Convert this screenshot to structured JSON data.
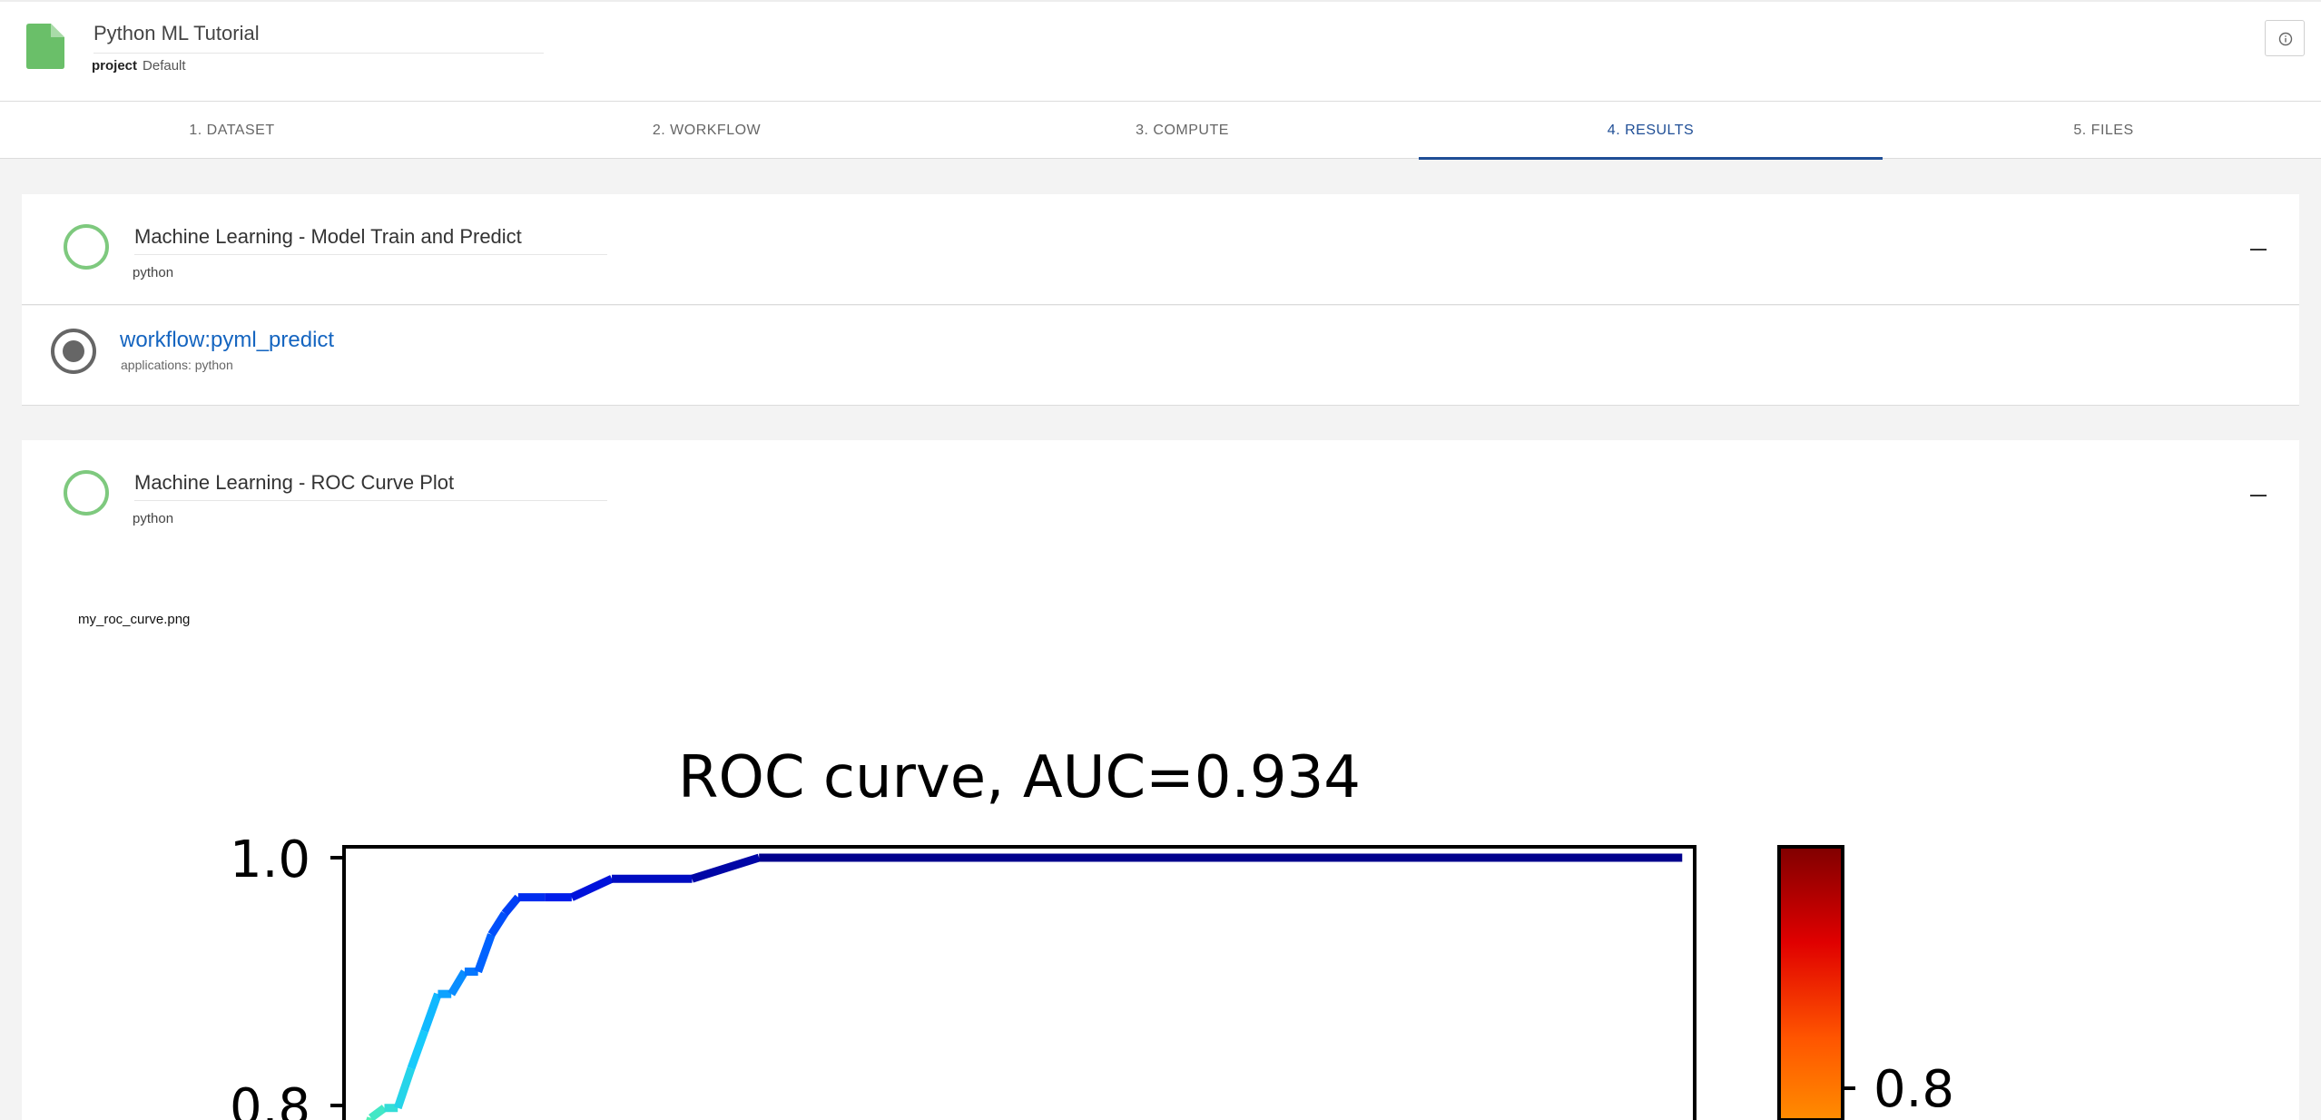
{
  "header": {
    "title": "Python ML Tutorial",
    "project_label": "project",
    "project_value": "Default"
  },
  "tabs": [
    {
      "label": "1. DATASET",
      "active": false
    },
    {
      "label": "2. WORKFLOW",
      "active": false
    },
    {
      "label": "3. COMPUTE",
      "active": false
    },
    {
      "label": "4. RESULTS",
      "active": true
    },
    {
      "label": "5. FILES",
      "active": false
    }
  ],
  "cards": [
    {
      "title": "Machine Learning - Model Train and Predict",
      "subtitle": "python"
    },
    {
      "title": "Machine Learning - ROC Curve Plot",
      "subtitle": "python"
    }
  ],
  "workflow": {
    "name": "workflow:pyml_predict",
    "applications": "applications: python"
  },
  "plot": {
    "filename": "my_roc_curve.png"
  },
  "colors": {
    "accent": "#1f4e96",
    "status_ring": "#7ec97e",
    "link": "#1565c0"
  },
  "chart_data": {
    "type": "line",
    "title": "ROC curve, AUC=0.934",
    "y_ticks": [
      "1.0",
      "0.8"
    ],
    "colorbar_ticks": [
      "0.8"
    ],
    "colormap": "jet",
    "series": [
      {
        "x": [
          0.0,
          0.01,
          0.02,
          0.03,
          0.04,
          0.05,
          0.06,
          0.07,
          0.08,
          0.09,
          0.1,
          0.11,
          0.12,
          0.14,
          0.16,
          0.19,
          0.25,
          0.3,
          0.99
        ],
        "y": [
          0.755,
          0.79,
          0.798,
          0.798,
          0.83,
          0.86,
          0.89,
          0.89,
          0.908,
          0.908,
          0.938,
          0.955,
          0.968,
          0.968,
          0.968,
          0.983,
          0.983,
          1.0,
          1.0
        ]
      }
    ]
  }
}
